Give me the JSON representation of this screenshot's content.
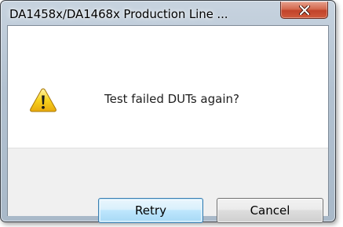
{
  "window": {
    "title": "DA1458x/DA1468x Production Line ...",
    "close_icon": "close-x-icon"
  },
  "dialog": {
    "icon": "warning-icon",
    "message": "Test failed DUTs again?"
  },
  "buttons": {
    "retry_label": "Retry",
    "cancel_label": "Cancel"
  },
  "colors": {
    "close_button": "#c7432a",
    "warning_yellow": "#f7d21e",
    "default_button_border": "#3c7fb1"
  }
}
